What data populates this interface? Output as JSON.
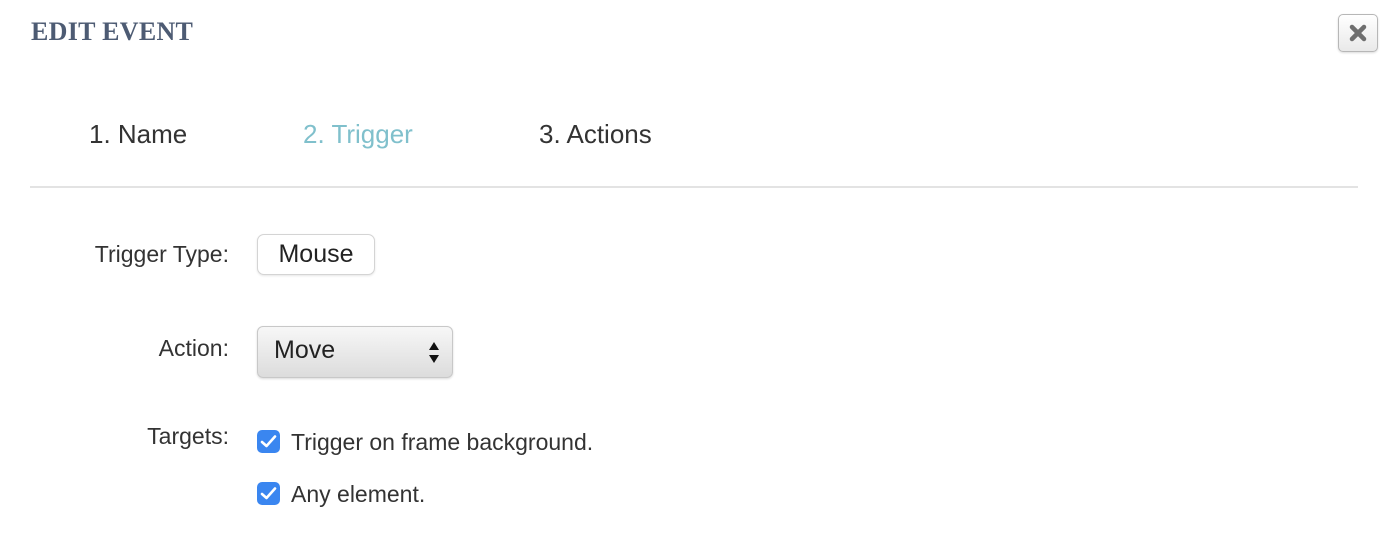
{
  "dialog": {
    "title": "EDIT EVENT"
  },
  "close_button": {
    "icon": "close-icon"
  },
  "tabs": [
    {
      "label": "1. Name",
      "active": false
    },
    {
      "label": "2. Trigger",
      "active": true
    },
    {
      "label": "3. Actions",
      "active": false
    }
  ],
  "form": {
    "trigger_type": {
      "label": "Trigger Type:",
      "value": "Mouse"
    },
    "action": {
      "label": "Action:",
      "selected": "Move"
    },
    "targets": {
      "label": "Targets:",
      "options": [
        {
          "label": "Trigger on frame background.",
          "checked": true
        },
        {
          "label": "Any element.",
          "checked": true
        }
      ]
    }
  },
  "colors": {
    "title": "#4d5b73",
    "active_tab": "#80c0cc",
    "checkbox": "#3a86f0"
  }
}
